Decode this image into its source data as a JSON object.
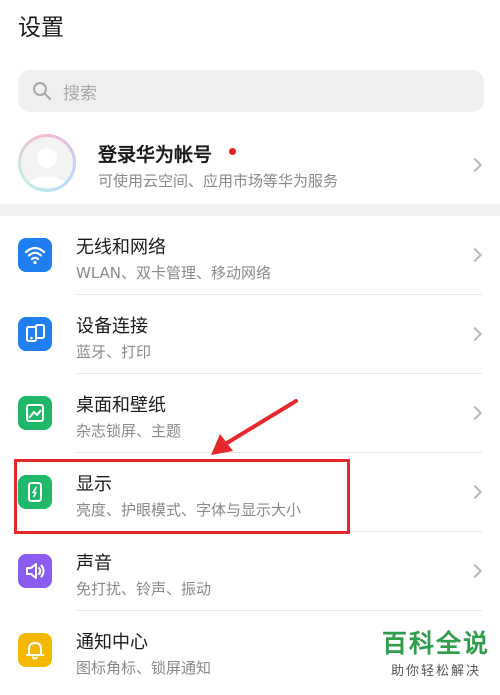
{
  "page": {
    "title": "设置"
  },
  "search": {
    "placeholder": "搜索"
  },
  "account": {
    "title": "登录华为帐号",
    "subtitle": "可使用云空间、应用市场等华为服务",
    "badge_color": "#e8221b"
  },
  "items": [
    {
      "label": "无线和网络",
      "sub": "WLAN、双卡管理、移动网络",
      "icon": "wifi-icon",
      "color": "#1f7ff0"
    },
    {
      "label": "设备连接",
      "sub": "蓝牙、打印",
      "icon": "device-connect-icon",
      "color": "#1f7ff0"
    },
    {
      "label": "桌面和壁纸",
      "sub": "杂志锁屏、主题",
      "icon": "wallpaper-icon",
      "color": "#1fb86a"
    },
    {
      "label": "显示",
      "sub": "亮度、护眼模式、字体与显示大小",
      "icon": "display-icon",
      "color": "#1fb86a"
    },
    {
      "label": "声音",
      "sub": "免打扰、铃声、振动",
      "icon": "sound-icon",
      "color": "#8a5cf0"
    },
    {
      "label": "通知中心",
      "sub": "图标角标、锁屏通知",
      "icon": "bell-icon",
      "color": "#f5b800"
    }
  ],
  "annotation": {
    "color": "#e4282c"
  },
  "watermark": {
    "title": "百科全说",
    "subtitle": "助你轻松解决",
    "color": "#2f9d4c"
  }
}
